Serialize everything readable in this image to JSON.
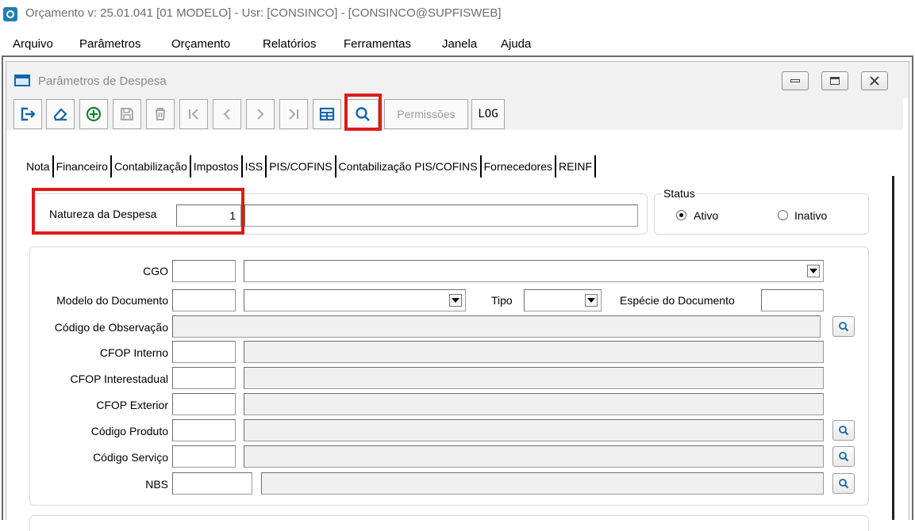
{
  "window": {
    "title": "Orçamento  v: 25.01.041   [01 MODELO] - Usr: [CONSINCO] - [CONSINCO@SUPFISWEB]"
  },
  "menu": {
    "items": [
      "Arquivo",
      "Parâmetros",
      "Orçamento",
      "Relatórios",
      "Ferramentas",
      "Janela",
      "Ajuda"
    ]
  },
  "child_window": {
    "title": "Parâmetros de Despesa"
  },
  "toolbar": {
    "permissions_label": "Permissões",
    "log_label": "LOG"
  },
  "tabs": [
    "Nota",
    "Financeiro",
    "Contabilização",
    "Impostos",
    "ISS",
    "PIS/COFINS",
    "Contabilização PIS/COFINS",
    "Fornecedores",
    "REINF"
  ],
  "header": {
    "natureza_label": "Natureza da Despesa",
    "natureza_code": "1",
    "natureza_desc": ""
  },
  "status": {
    "label": "Status",
    "ativo_label": "Ativo",
    "inativo_label": "Inativo",
    "selected": "Ativo"
  },
  "form": {
    "cgo_label": "CGO",
    "modelo_label": "Modelo do Documento",
    "tipo_label": "Tipo",
    "especie_label": "Espécie do Documento",
    "observacao_label": "Código de Observação",
    "cfop_interno_label": "CFOP Interno",
    "cfop_interestadual_label": "CFOP Interestadual",
    "cfop_exterior_label": "CFOP Exterior",
    "produto_label": "Código Produto",
    "servico_label": "Código Serviço",
    "nbs_label": "NBS"
  },
  "colors": {
    "highlight": "#e01a1a",
    "icon_blue": "#1767a8",
    "add_green": "#1a7f37"
  }
}
